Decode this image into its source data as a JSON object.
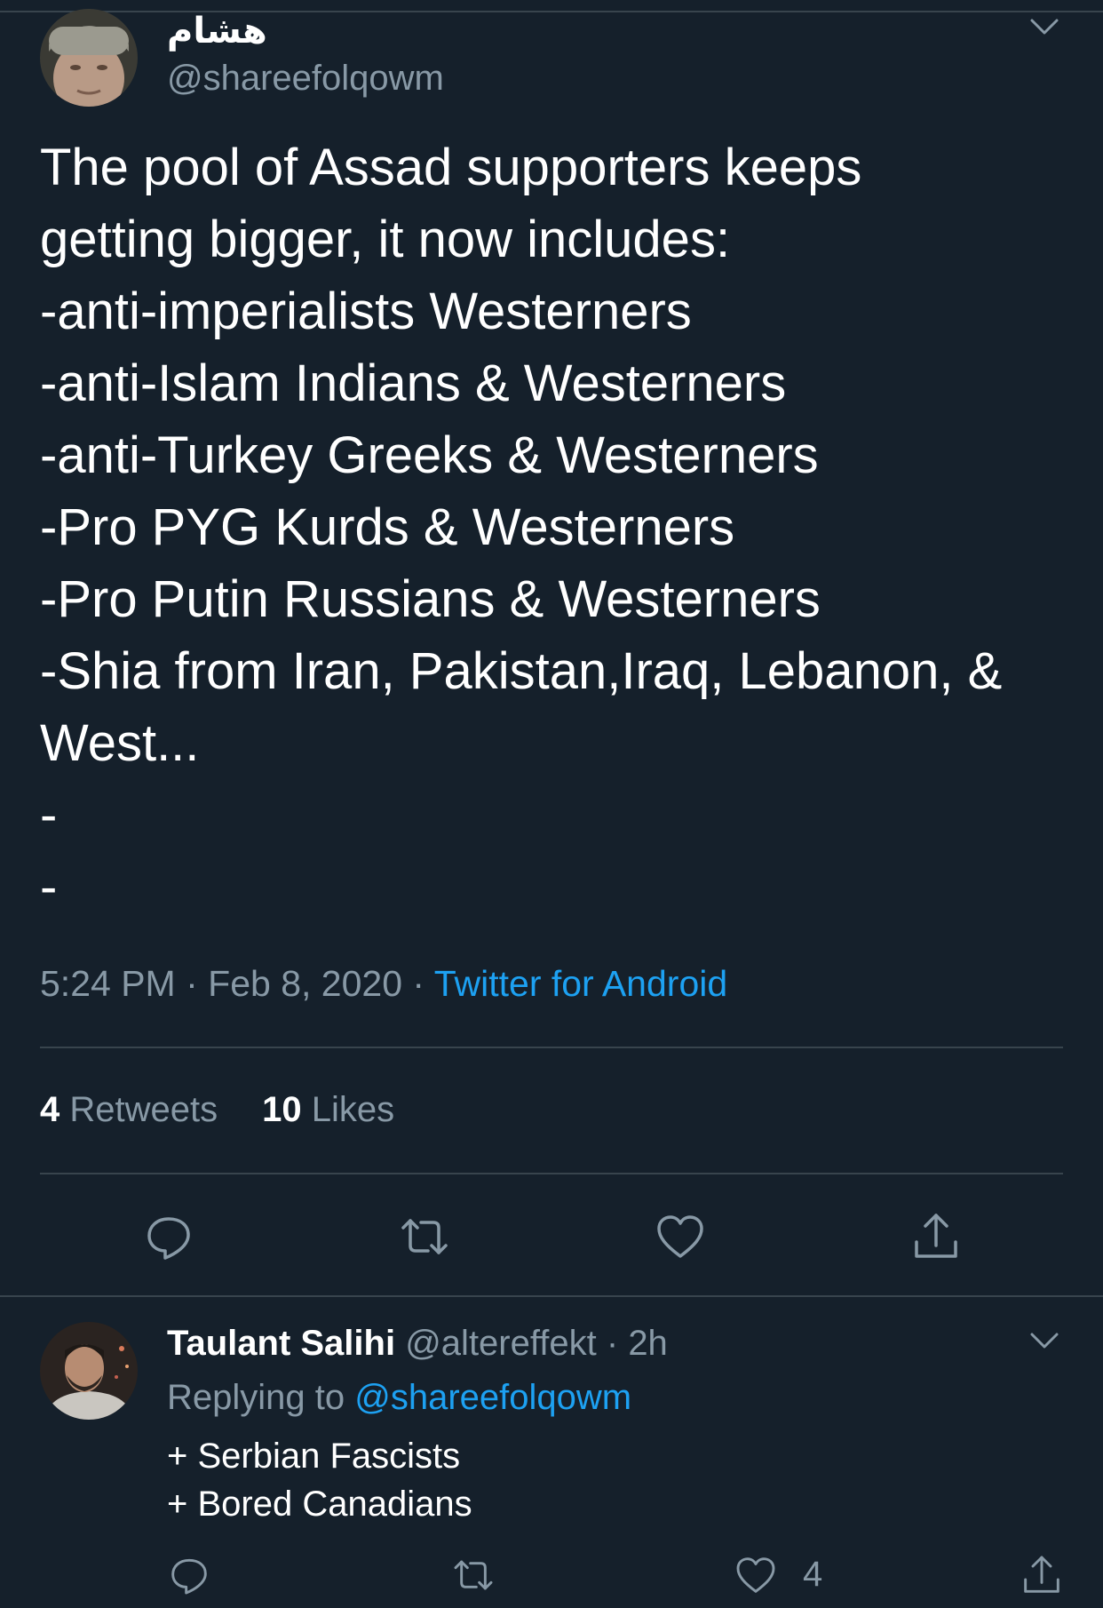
{
  "tweet": {
    "author_name": "هشام",
    "author_handle": "@shareefolqowm",
    "text": "The pool of Assad supporters keeps\ngetting bigger, it now includes:\n-anti-imperialists Westerners\n-anti-Islam Indians & Westerners\n-anti-Turkey Greeks & Westerners\n-Pro PYG Kurds & Westerners\n-Pro Putin Russians & Westerners\n-Shia from Iran, Pakistan,Iraq, Lebanon, &\nWest...\n-\n-",
    "time": "5:24 PM",
    "date": "Feb 8, 2020",
    "separator": "·",
    "source": "Twitter for Android",
    "retweets_count": "4",
    "retweets_label": "Retweets",
    "likes_count": "10",
    "likes_label": "Likes"
  },
  "reply": {
    "author_name": "Taulant Salihi",
    "author_handle": "@altereffekt",
    "separator": "·",
    "time_ago": "2h",
    "replying_label": "Replying to",
    "replying_handle": "@shareefolqowm",
    "text": "+ Serbian Fascists\n+ Bored Canadians",
    "like_count": "4"
  },
  "icons": {
    "caret": "chevron-down-icon",
    "reply": "reply-icon",
    "retweet": "retweet-icon",
    "like": "heart-icon",
    "share": "share-icon"
  },
  "colors": {
    "background": "#15202b",
    "secondary_text": "#8899a6",
    "link": "#1da1f2",
    "divider": "#38444d"
  }
}
